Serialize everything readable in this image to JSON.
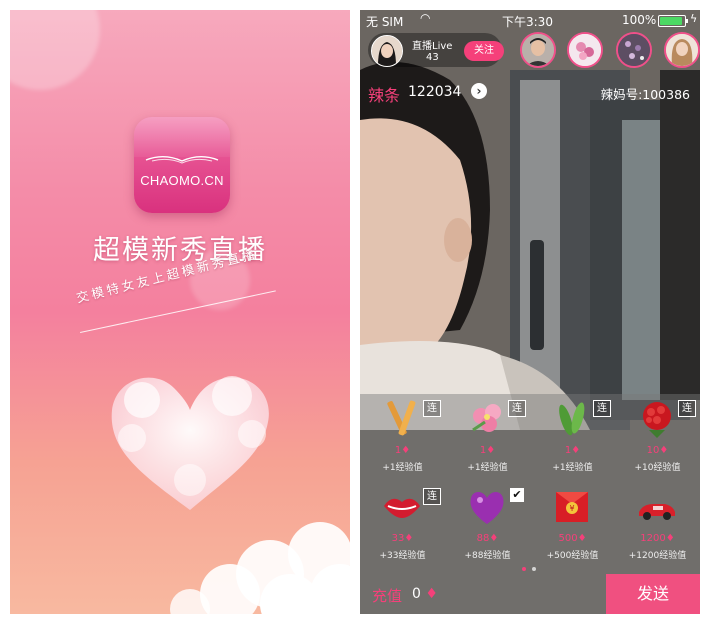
{
  "splash": {
    "icon_text": "CHAOMO.CN",
    "app_title": "超模新秀直播",
    "tagline": "交模特女友上超模新秀直播",
    "colors": {
      "bg_top": "#f7a9bd",
      "bg_bottom": "#f8b9a0",
      "icon": "#e0418a"
    }
  },
  "live": {
    "status": {
      "carrier": "无 SIM",
      "time": "下午3:30",
      "battery": "100%"
    },
    "host": {
      "name": "直播Live",
      "count": "43",
      "follow_label": "关注"
    },
    "viewers": [
      "viewer-1",
      "viewer-2",
      "viewer-3",
      "viewer-4"
    ],
    "lajiao_label": "辣条",
    "lajiao_count": "122034",
    "room_id": "辣妈号:100386",
    "gifts": [
      {
        "icon": "chopsticks-gift-icon",
        "price": "1",
        "exp": "+1经验值",
        "lian": "连"
      },
      {
        "icon": "flower-gift-icon",
        "price": "1",
        "exp": "+1经验值",
        "lian": "连"
      },
      {
        "icon": "cucumber-gift-icon",
        "price": "1",
        "exp": "+1经验值",
        "lian": "连"
      },
      {
        "icon": "rose-bouquet-gift-icon",
        "price": "10",
        "exp": "+10经验值",
        "lian": "连"
      },
      {
        "icon": "lips-gift-icon",
        "price": "33",
        "exp": "+33经验值",
        "lian": "连"
      },
      {
        "icon": "heart-gift-icon",
        "price": "88",
        "exp": "+88经验值",
        "check": "✔"
      },
      {
        "icon": "red-envelope-gift-icon",
        "price": "500",
        "exp": "+500经验值"
      },
      {
        "icon": "sports-car-gift-icon",
        "price": "1200",
        "exp": "+1200经验值"
      }
    ],
    "recharge_label": "充值",
    "balance": "0",
    "send_label": "发送",
    "colors": {
      "accent": "#f5407a",
      "send_bg": "#f05080"
    }
  }
}
